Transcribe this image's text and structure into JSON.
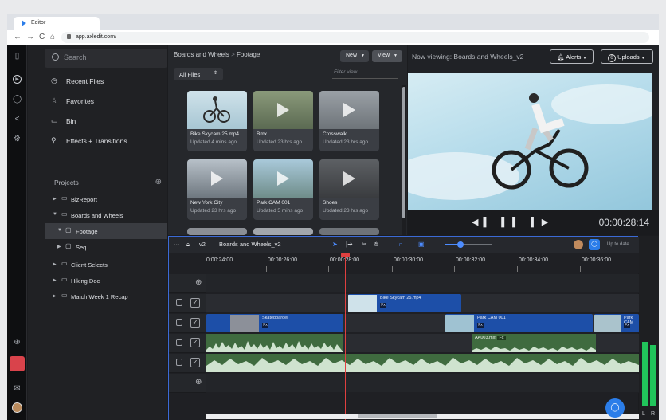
{
  "browser": {
    "tab_title": "Editor",
    "url": "app.axledit.com/"
  },
  "sidebar": {
    "search_placeholder": "Search",
    "nav": [
      {
        "label": "Recent Files",
        "icon": "clock-icon"
      },
      {
        "label": "Favorites",
        "icon": "star-icon"
      },
      {
        "label": "Bin",
        "icon": "bin-icon"
      },
      {
        "label": "Effects + Transitions",
        "icon": "effects-icon"
      }
    ],
    "projects_label": "Projects",
    "tree": [
      {
        "label": "BizReport"
      },
      {
        "label": "Boards and Wheels"
      },
      {
        "label": "Footage"
      },
      {
        "label": "Seq"
      },
      {
        "label": "Client Selects"
      },
      {
        "label": "Hiking Doc"
      },
      {
        "label": "Match Week 1 Recap"
      }
    ]
  },
  "files": {
    "breadcrumb": {
      "project": "Boards and Wheels",
      "sep": ">",
      "folder": "Footage"
    },
    "new_label": "New",
    "view_label": "View",
    "filter_dropdown": "All Files",
    "filter_placeholder": "Filter view...",
    "items": [
      {
        "name": "Bike Skycam 25.mp4",
        "updated": "Updated 4 mins ago"
      },
      {
        "name": "Bmx",
        "updated": "Updated 23 hrs ago"
      },
      {
        "name": "Crosswalk",
        "updated": "Updated 23 hrs ago"
      },
      {
        "name": "New York City",
        "updated": "Updated 23 hrs ago"
      },
      {
        "name": "Park CAM 001",
        "updated": "Updated 5 mins ago"
      },
      {
        "name": "Shoes",
        "updated": "Updated 23 hrs ago"
      }
    ]
  },
  "viewer": {
    "title": "Now viewing: Boards and Wheels_v2",
    "alerts_label": "Alerts",
    "uploads_count": "0",
    "uploads_label": "Uploads",
    "timecode": "00:00:28:14",
    "transport": "◀▌ ▌▌ ▌▶"
  },
  "timeline": {
    "more": "···",
    "version": "v2",
    "sequence_name": "Boards and Wheels_v2",
    "status": "Up to date",
    "ruler": [
      "0:00:24:00",
      "00:00:26:00",
      "00:00:28:00",
      "00:00:30:00",
      "00:00:32:00",
      "00:00:34:00",
      "00:00:36:00"
    ],
    "clips": {
      "v2": {
        "label": "Bike Skycam 25.mp4",
        "badge": "Fx"
      },
      "v1a": {
        "label": "Skateboarder",
        "badge": "Fx"
      },
      "v1b": {
        "label": "Park CAM 001",
        "badge": "Fx"
      },
      "v1c": {
        "label": "Park CAM",
        "badge": "Fx"
      },
      "a1": {
        "label": "AA003.mxf",
        "badge": "Fx"
      }
    },
    "meter": {
      "left_label": "L",
      "right_label": "R",
      "left_level": 0.42,
      "right_level": 0.4
    },
    "colors": {
      "video_clip": "#1d4fa8",
      "audio_clip": "#3f6b3f",
      "playhead": "#e04040",
      "accent": "#2b7de9"
    }
  }
}
